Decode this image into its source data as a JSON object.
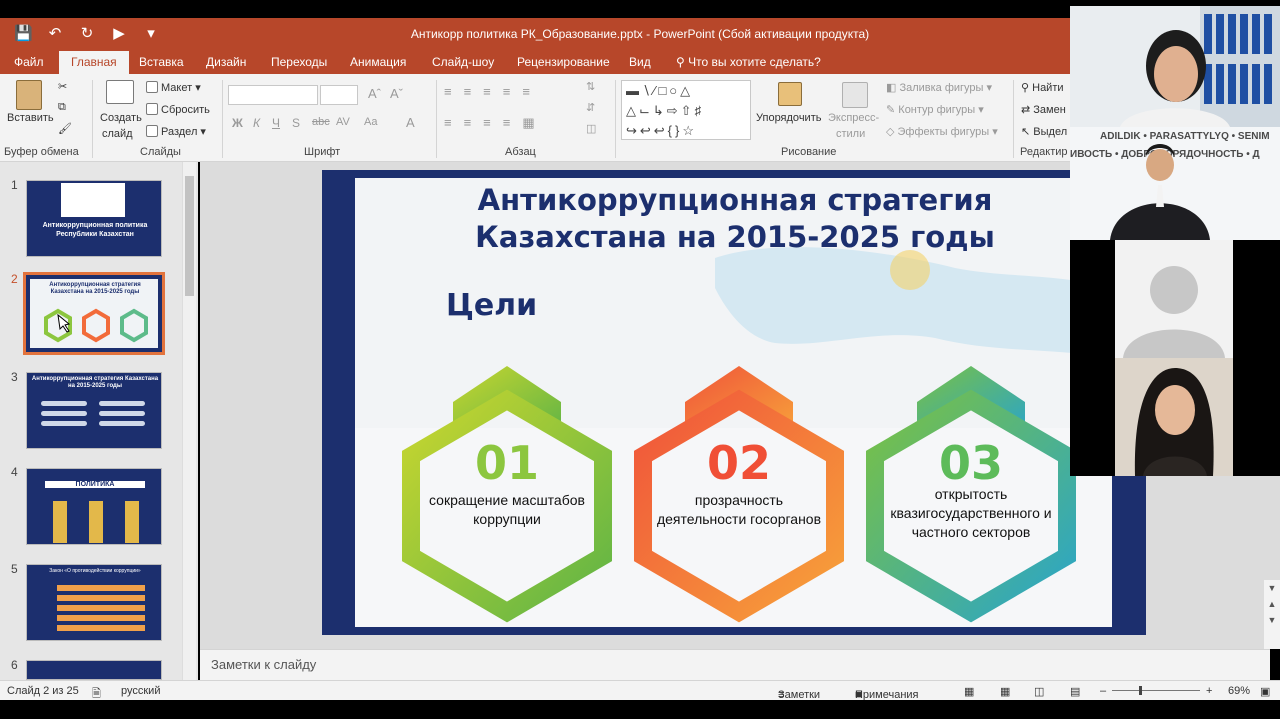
{
  "window": {
    "title": "Антикорр политика РК_Образование.pptx - PowerPoint (Сбой активации продукта)"
  },
  "tabs": [
    "Файл",
    "Главная",
    "Вставка",
    "Дизайн",
    "Переходы",
    "Анимация",
    "Слайд-шоу",
    "Рецензирование",
    "Вид"
  ],
  "tell_me": "Что вы хотите сделать?",
  "ribbon": {
    "clipboard": {
      "paste": "Вставить",
      "label": "Буфер обмена"
    },
    "slides": {
      "new_slide": "Создать",
      "new_slide2": "слайд",
      "layout": "Макет",
      "reset": "Сбросить",
      "section": "Раздел",
      "label": "Слайды"
    },
    "font": {
      "label": "Шрифт",
      "buttons": [
        "Ж",
        "К",
        "Ч",
        "S",
        "abc",
        "AV",
        "Aa",
        "A"
      ]
    },
    "paragraph": {
      "label": "Абзац"
    },
    "drawing": {
      "arrange": "Упорядочить",
      "quick_styles": "Экспресс-",
      "quick_styles2": "стили",
      "fill": "Заливка фигуры",
      "outline": "Контур фигуры",
      "effects": "Эффекты фигуры",
      "label": "Рисование"
    },
    "editing": {
      "find": "Найти",
      "replace": "Замен",
      "select": "Выдел",
      "label": "Редактир"
    }
  },
  "thumbnails": [
    {
      "num": "1",
      "title": "Антикоррупционная политика Республики Казахстан"
    },
    {
      "num": "2",
      "title": "Антикоррупционная стратегия Казахстана на 2015-2025 годы"
    },
    {
      "num": "3",
      "title": "Антикоррупционная стратегия Казахстана на 2015-2025 годы"
    },
    {
      "num": "4",
      "title": "ПОЛИТИКА"
    },
    {
      "num": "5",
      "title": "Закон «О противодействии коррупции»"
    },
    {
      "num": "6",
      "title": ""
    }
  ],
  "slide": {
    "title": "Антикоррупционная стратегия Казахстана на 2015-2025 годы",
    "goals_heading": "Цели",
    "goals": [
      {
        "num": "01",
        "text": "сокращение масштабов коррупции",
        "color": "#8cc63f"
      },
      {
        "num": "02",
        "text": "прозрачность деятельности госорганов",
        "color": "#f26b3a"
      },
      {
        "num": "03",
        "text": "открытость квазигосударственного и частного секторов",
        "color": "#5dbb8a"
      }
    ]
  },
  "notes": "Заметки к слайду",
  "status": {
    "slide_of": "Слайд 2 из 25",
    "language": "русский",
    "notes_btn": "Заметки",
    "comments_btn": "Примечания",
    "zoom": "69%"
  },
  "video": {
    "banner_top": "ADILDIK • PARASATTYLYQ • SENIM",
    "banner_bottom": "ИВОСТЬ • ДОБРОПОРЯДОЧНОСТЬ • Д"
  },
  "colors": {
    "brand": "#b7472a",
    "slide_navy": "#1c2f6e",
    "selection": "#e2733d"
  }
}
